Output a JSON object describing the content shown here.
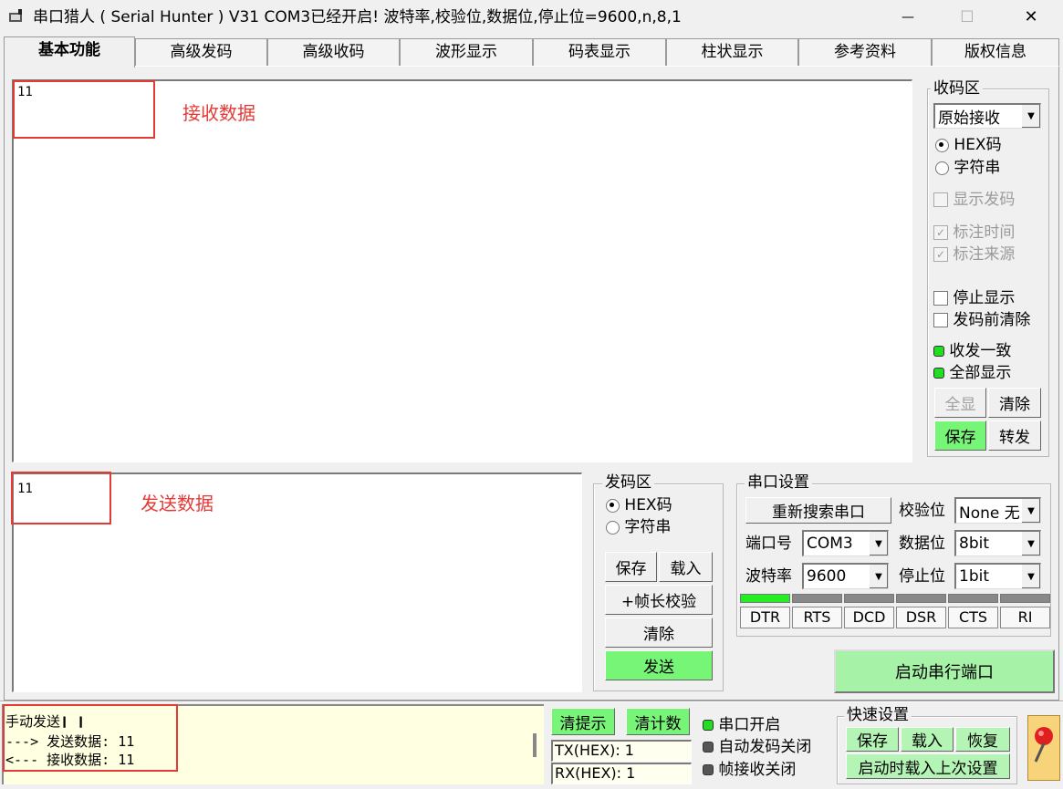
{
  "window": {
    "title": "串口猎人 ( Serial Hunter ) V31    COM3已经开启!   波特率,校验位,数据位,停止位=9600,n,8,1",
    "minimize": "—",
    "maximize": "☐",
    "close": "✕"
  },
  "tabs": [
    "基本功能",
    "高级发码",
    "高级收码",
    "波形显示",
    "码表显示",
    "柱状显示",
    "参考资料",
    "版权信息"
  ],
  "receive": {
    "text": "11",
    "annotation": "接收数据"
  },
  "send": {
    "text": "11",
    "annotation": "发送数据"
  },
  "recv_panel": {
    "title": "收码区",
    "mode_value": "原始接收",
    "radio_hex": "HEX码",
    "radio_str": "字符串",
    "chk_show_send": "显示发码",
    "chk_mark_time": "标注时间",
    "chk_mark_src": "标注来源",
    "chk_stop_display": "停止显示",
    "chk_clear_before": "发码前清除",
    "led_consistent": "收发一致",
    "led_show_all": "全部显示",
    "btn_all": "全显",
    "btn_clear": "清除",
    "btn_save": "保存",
    "btn_forward": "转发"
  },
  "send_panel": {
    "title": "发码区",
    "radio_hex": "HEX码",
    "radio_str": "字符串",
    "btn_save": "保存",
    "btn_load": "载入",
    "btn_frame": "+帧长校验",
    "btn_clear": "清除",
    "btn_send": "发送"
  },
  "port": {
    "title": "串口设置",
    "btn_rescan": "重新搜索串口",
    "lbl_parity": "校验位",
    "parity": "None 无",
    "lbl_port": "端口号",
    "port": "COM3",
    "lbl_databits": "数据位",
    "databits": "8bit",
    "lbl_baud": "波特率",
    "baud": "9600",
    "lbl_stopbits": "停止位",
    "stopbits": "1bit",
    "pins": [
      "DTR",
      "RTS",
      "DCD",
      "DSR",
      "CTS",
      "RI"
    ],
    "btn_start": "启动串行端口"
  },
  "log": {
    "line1": "手动发送❙ ❙",
    "line2": "---> 发送数据: 11",
    "line3": "<--- 接收数据: 11"
  },
  "status": {
    "btn_clear_tips": "清提示",
    "btn_clear_count": "清计数",
    "tx": "TX(HEX): 1",
    "rx": "RX(HEX): 1",
    "led_port_open": "串口开启",
    "led_auto_close": "自动发码关闭",
    "led_frame_close": "帧接收关闭"
  },
  "quick": {
    "title": "快速设置",
    "btn_save": "保存",
    "btn_load": "载入",
    "btn_restore": "恢复",
    "btn_startup": "启动时载入上次设置"
  },
  "colors": {
    "accent_green": "#77f577",
    "led_green": "#22dd22",
    "annotation_red": "#e53935",
    "log_bg": "#ffffe1"
  }
}
